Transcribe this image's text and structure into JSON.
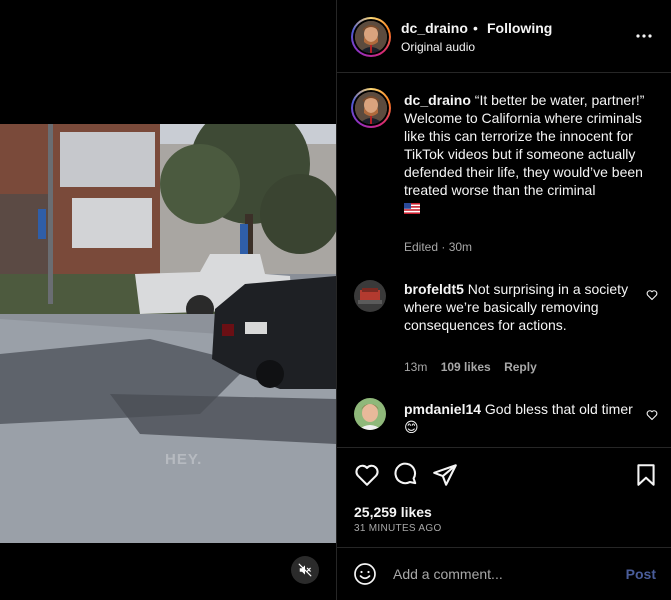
{
  "post": {
    "username": "dc_draino",
    "follow_separator": "•",
    "follow_label": "Following",
    "audio_label": "Original audio",
    "more_icon": "more-horizontal-icon"
  },
  "caption": {
    "username": "dc_draino",
    "text": "“It better be water, partner!” Welcome to California where criminals like this can terrorize the innocent for TikTok videos but if someone actually defended their life, they would’ve been treated worse than the criminal",
    "flag_icon": "us-flag-icon",
    "meta": "Edited · 30m"
  },
  "comments": [
    {
      "username": "brofeldt5",
      "text": "Not surprising in a society where we’re basically removing consequences for actions.",
      "time": "13m",
      "likes": "109 likes",
      "reply": "Reply"
    },
    {
      "username": "pmdaniel14",
      "text": "God bless that old timer",
      "emoji": "😊"
    }
  ],
  "actions": {
    "likes": "25,259 likes",
    "time_ago": "31 MINUTES AGO"
  },
  "composer": {
    "placeholder": "Add a comment...",
    "post_label": "Post"
  },
  "video": {
    "watermark": "HEY.",
    "mute_icon": "muted-speaker-icon"
  },
  "colors": {
    "background": "#000000",
    "text": "#f5f5f5",
    "secondary_text": "#a8a8a8",
    "divider": "#262626",
    "post_button": "#4a5d9a"
  }
}
